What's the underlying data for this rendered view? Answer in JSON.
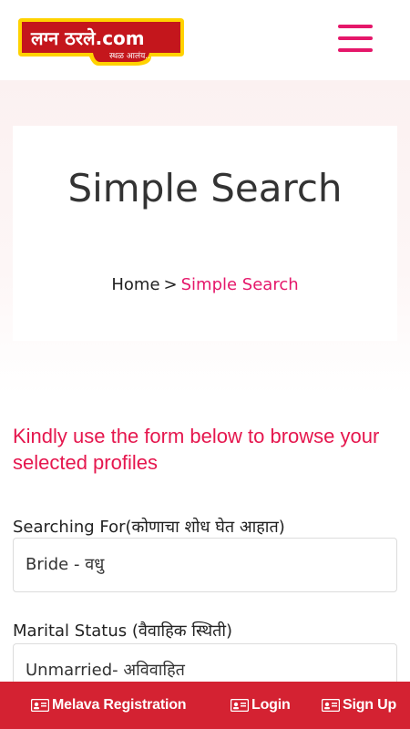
{
  "header": {
    "logo_text": "लग्न ठरले.com",
    "logo_tagline": "स्थळ आलंय...",
    "menu_icon": "hamburger-menu-icon"
  },
  "banner": {
    "title": "Simple Search",
    "breadcrumb": {
      "home": "Home",
      "separator": ">",
      "current": "Simple Search"
    }
  },
  "form": {
    "intro": "Kindly use the form below to browse your selected profiles",
    "searching_for": {
      "label": "Searching For(कोणाचा शोध घेत आहात)",
      "value": "Bride - वधु"
    },
    "marital_status": {
      "label": "Marital Status (वैवाहिक स्थिती)",
      "value": "Unmarried- अविवाहित"
    }
  },
  "bottom_bar": {
    "melava": "Melava Registration",
    "login": "Login",
    "signup": "Sign Up",
    "icon": "id-card-icon"
  },
  "colors": {
    "accent": "#e5176a",
    "intro_red": "#e5174e",
    "bottom_bar": "#d42232",
    "logo_red": "#c4161c",
    "logo_yellow": "#ffd200"
  }
}
